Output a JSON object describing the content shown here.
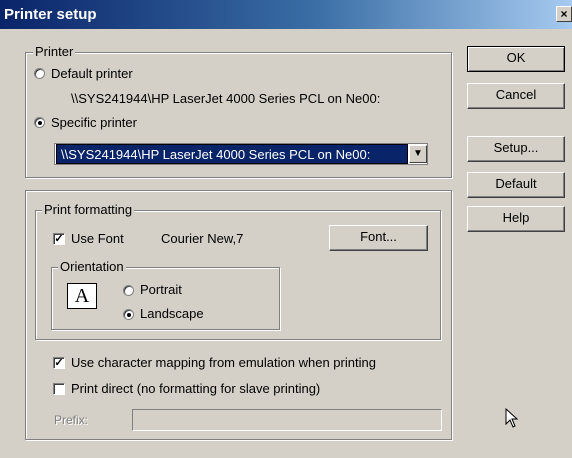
{
  "window": {
    "title": "Printer setup",
    "close_glyph": "×"
  },
  "printer_group": {
    "legend": "Printer",
    "default_label": "Default printer",
    "default_path": "\\\\SYS241944\\HP LaserJet 4000 Series PCL on Ne00:",
    "specific_label": "Specific printer",
    "selected_printer": "\\\\SYS241944\\HP LaserJet 4000 Series PCL on Ne00:"
  },
  "buttons": {
    "ok": "OK",
    "cancel": "Cancel",
    "setup": "Setup...",
    "default": "Default",
    "help": "Help"
  },
  "formatting_group": {
    "legend": "Print formatting",
    "use_font_label": "Use Font",
    "font_value": "Courier New,7",
    "font_button": "Font...",
    "orientation_legend": "Orientation",
    "orientation_icon_letter": "A",
    "portrait_label": "Portrait",
    "landscape_label": "Landscape"
  },
  "options": {
    "char_mapping_label": "Use character mapping from emulation when printing",
    "print_direct_label": "Print direct (no formatting for slave printing)",
    "prefix_label": "Prefix:",
    "prefix_value": ""
  },
  "state": {
    "printer_choice": "specific",
    "use_font": true,
    "orientation": "landscape",
    "char_mapping": true,
    "print_direct": false
  }
}
